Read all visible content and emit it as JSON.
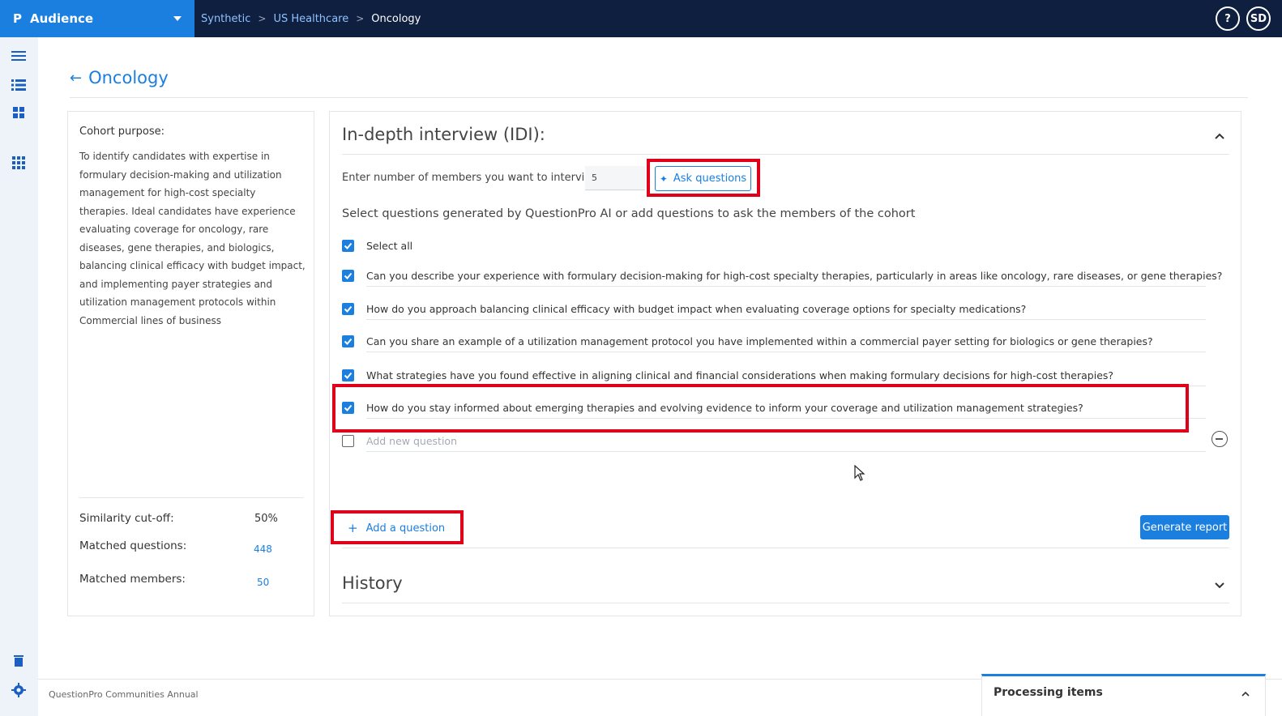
{
  "app": {
    "logo": "P",
    "name": "Audience"
  },
  "breadcrumb": [
    "Synthetic",
    "US Healthcare",
    "Oncology"
  ],
  "top_icons": {
    "help": "?",
    "user_initials": "SD"
  },
  "page": {
    "title": "Oncology"
  },
  "cohort": {
    "purpose_label": "Cohort purpose:",
    "purpose_text": "To identify candidates with expertise in formulary decision-making and utilization management for high-cost specialty therapies. Ideal candidates have experience evaluating coverage for oncology, rare diseases, gene therapies, and biologics, balancing clinical efficacy with budget impact, and implementing payer strategies and utilization management protocols within Commercial lines of business",
    "similarity_label": "Similarity cut-off:",
    "similarity_value": "50%",
    "matched_questions_label": "Matched questions:",
    "matched_questions_value": "448",
    "matched_members_label": "Matched members:",
    "matched_members_value": "50"
  },
  "idi": {
    "title": "In-depth interview (IDI):",
    "members_label": "Enter number of members you want to interview:",
    "members_value": "5",
    "ask_button": "Ask questions",
    "select_hint": "Select questions generated by QuestionPro AI or add questions to ask the members of the cohort",
    "select_all_label": "Select all",
    "select_all_checked": true,
    "questions": [
      {
        "text": "Can you describe your experience with formulary decision-making for high-cost specialty therapies, particularly in areas like oncology, rare diseases, or gene therapies?",
        "checked": true
      },
      {
        "text": "How do you approach balancing clinical efficacy with budget impact when evaluating coverage options for specialty medications?",
        "checked": true
      },
      {
        "text": "Can you share an example of a utilization management protocol you have implemented within a commercial payer setting for biologics or gene therapies?",
        "checked": true
      },
      {
        "text": "What strategies have you found effective in aligning clinical and financial considerations when making formulary decisions for high-cost therapies?",
        "checked": true
      },
      {
        "text": "How do you stay informed about emerging therapies and evolving evidence to inform your coverage and utilization management strategies?",
        "checked": true
      }
    ],
    "new_question_placeholder": "Add new question",
    "add_question_button": "Add a question",
    "generate_button": "Generate report"
  },
  "history": {
    "title": "History"
  },
  "footer": {
    "text": "QuestionPro Communities Annual",
    "processing_title": "Processing items"
  },
  "colors": {
    "topbar": "#0e1f3f",
    "accent": "#1b7fe0",
    "highlight": "#e0001a",
    "rail": "#eef3fa"
  }
}
